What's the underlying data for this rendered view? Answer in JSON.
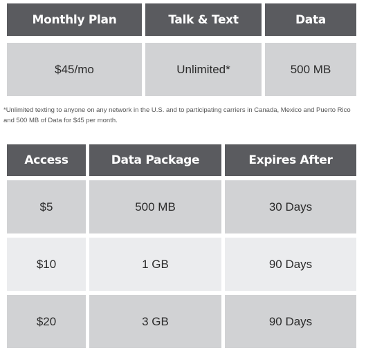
{
  "plan_table": {
    "headers": [
      "Monthly Plan",
      "Talk & Text",
      "Data"
    ],
    "rows": [
      [
        "$45/mo",
        "Unlimited*",
        "500 MB"
      ]
    ]
  },
  "footnote": "*Unlimited texting to anyone on any network in the U.S. and to participating carriers in Canada, Mexico and Puerto Rico and 500 MB of Data for $45 per month.",
  "data_table": {
    "headers": [
      "Access",
      "Data Package",
      "Expires After"
    ],
    "rows": [
      [
        "$5",
        "500 MB",
        "30 Days"
      ],
      [
        "$10",
        "1 GB",
        "90 Days"
      ],
      [
        "$20",
        "3 GB",
        "90 Days"
      ]
    ]
  },
  "colors": {
    "header_bg": "#5a5b5f",
    "row_dark_bg": "#d1d2d4",
    "row_light_bg": "#ebecee"
  }
}
